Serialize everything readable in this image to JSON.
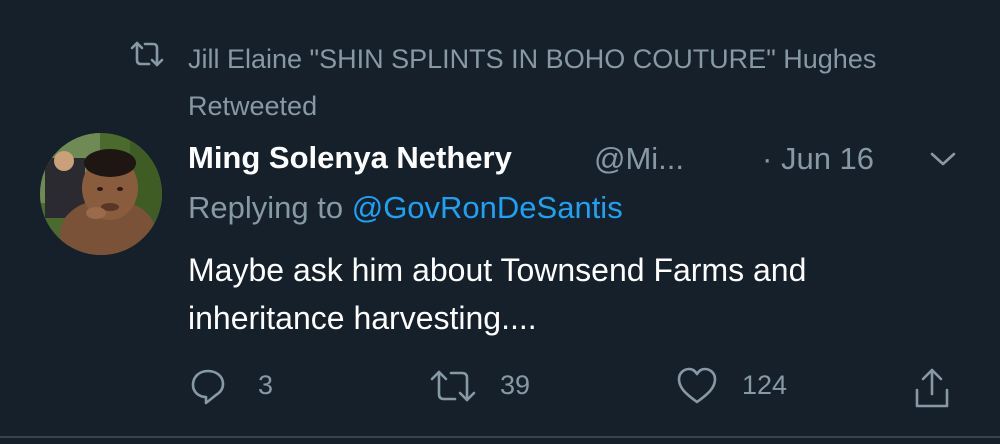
{
  "retweet_context": {
    "icon": "retweet-icon",
    "text": "Jill Elaine \"SHIN SPLINTS IN BOHO COUTURE\" Hughes Retweeted"
  },
  "tweet": {
    "display_name": "Ming Solenya Nethery",
    "handle": "@Mi...",
    "separator": "·",
    "date": "Jun 16",
    "replying_prefix": "Replying to",
    "replying_mention": "@GovRonDeSantis",
    "text": "Maybe ask him about Townsend Farms and inheritance harvesting....",
    "caret_icon": "chevron-down-icon"
  },
  "actions": {
    "reply": {
      "icon": "reply-icon",
      "count": "3"
    },
    "retweet": {
      "icon": "retweet-icon",
      "count": "39"
    },
    "like": {
      "icon": "heart-icon",
      "count": "124"
    },
    "share": {
      "icon": "share-icon"
    }
  },
  "colors": {
    "background": "#15202b",
    "secondary_text": "#8899a6",
    "primary_text": "#ffffff",
    "link": "#1da1f2",
    "divider": "#38444d"
  }
}
